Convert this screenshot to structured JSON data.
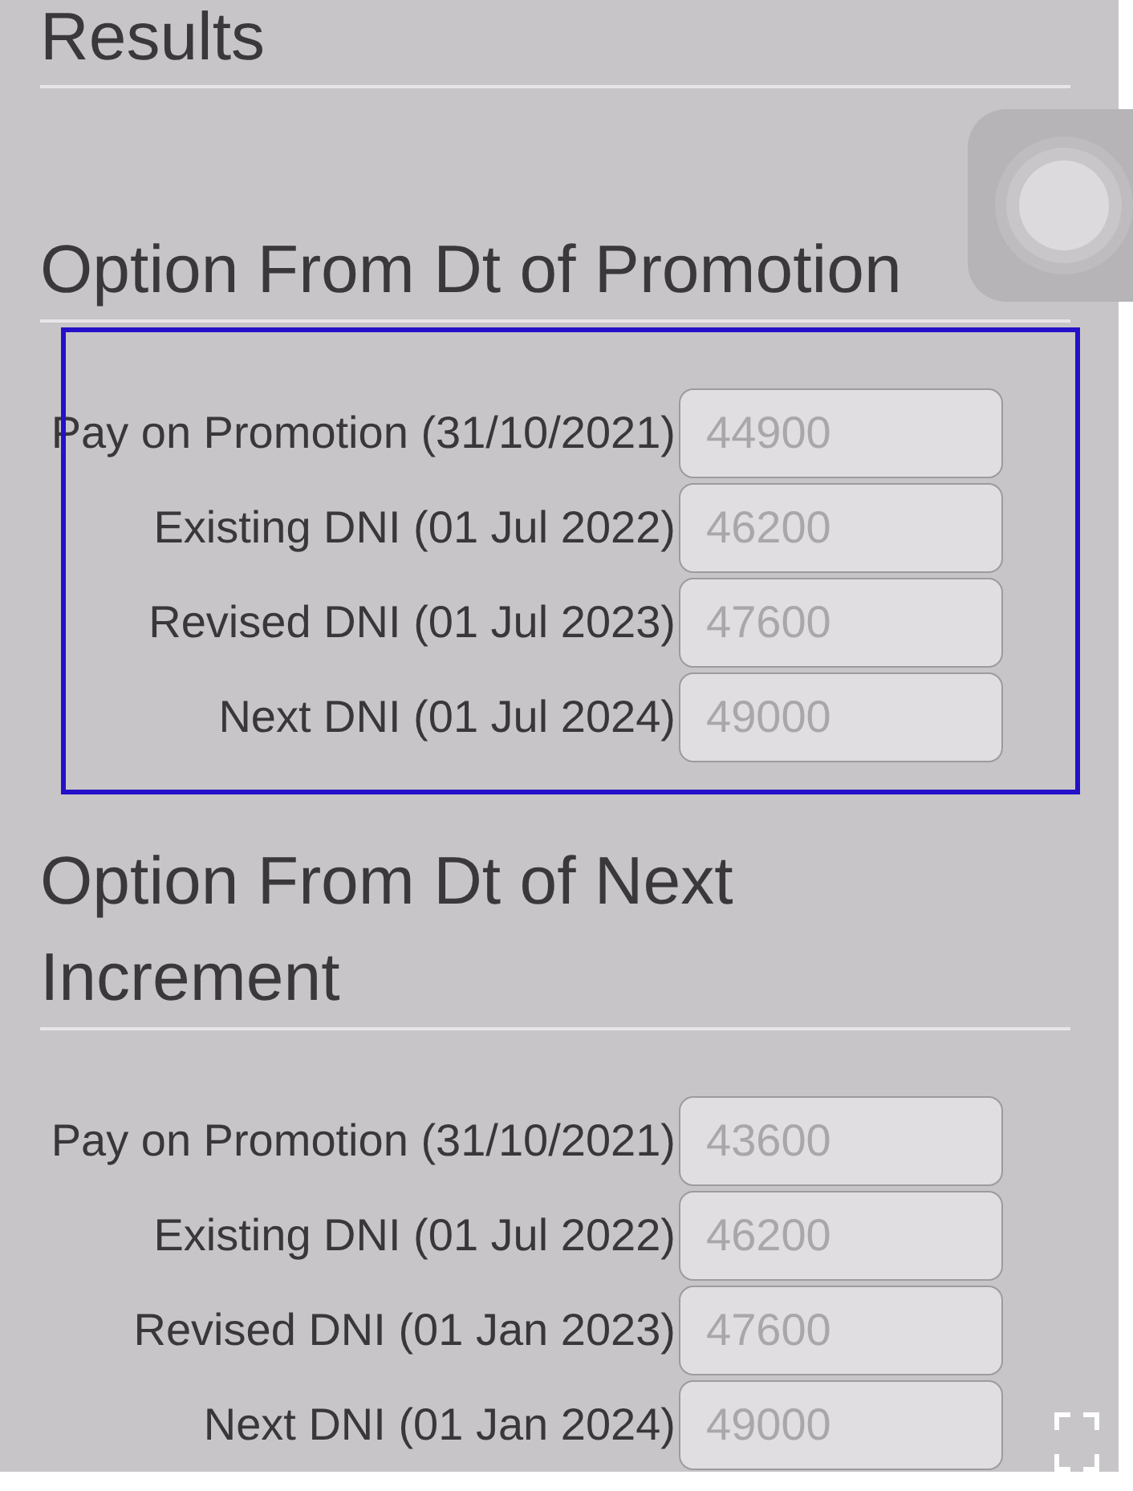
{
  "title": "Results",
  "sections": [
    {
      "title": "Option From Dt of Promotion",
      "highlighted": true,
      "rows": [
        {
          "label": "Pay on Promotion (31/10/2021)",
          "value": "44900",
          "disabled": true
        },
        {
          "label": "Existing DNI (01 Jul 2022)",
          "value": "46200",
          "disabled": true
        },
        {
          "label": "Revised DNI (01 Jul 2023)",
          "value": "47600",
          "disabled": true
        },
        {
          "label": "Next DNI (01 Jul 2024)",
          "value": "49000",
          "disabled": true
        }
      ]
    },
    {
      "title": "Option From Dt of Next Increment",
      "highlighted": false,
      "rows": [
        {
          "label": "Pay on Promotion (31/10/2021)",
          "value": "43600",
          "disabled": true
        },
        {
          "label": "Existing DNI (01 Jul 2022)",
          "value": "46200",
          "disabled": true
        },
        {
          "label": "Revised DNI (01 Jan 2023)",
          "value": "47600",
          "disabled": true
        },
        {
          "label": "Next DNI (01 Jan 2024)",
          "value": "49000",
          "disabled": true
        }
      ]
    }
  ]
}
